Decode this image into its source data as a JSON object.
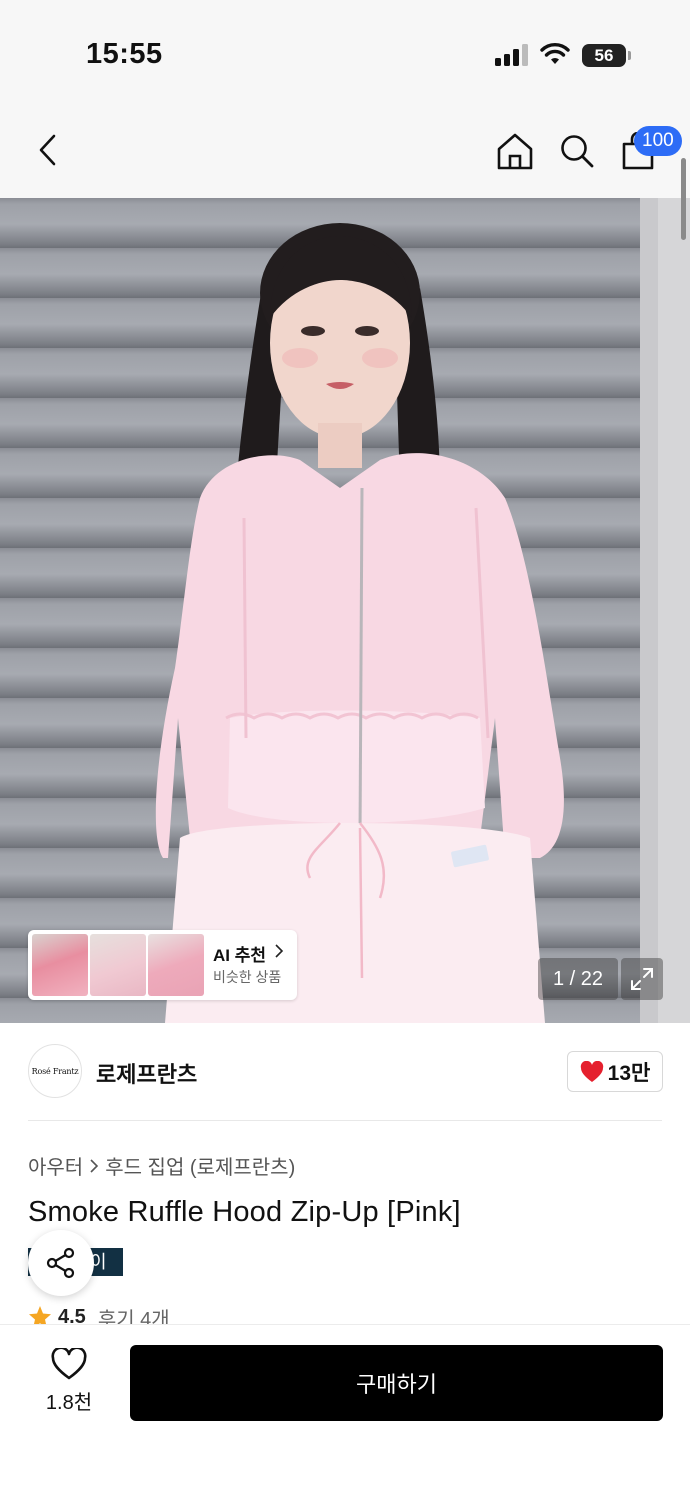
{
  "status_bar": {
    "time": "15:55",
    "battery": "56"
  },
  "nav": {
    "cart_badge": "100"
  },
  "hero": {
    "recommendation": {
      "title": "AI 추천",
      "subtitle": "비슷한 상품"
    },
    "pager": "1 / 22"
  },
  "brand": {
    "logo_text": "Rosé Frantz",
    "name": "로제프란츠",
    "likes": "13만"
  },
  "product": {
    "breadcrumb": [
      "아우터",
      "후드 집업 (로제프란츠)"
    ],
    "title": "Smoke Ruffle Hood Zip-Up [Pink]",
    "tag": "이",
    "rating": "4.5",
    "reviews": "후기 4개"
  },
  "bottom": {
    "wish_count": "1.8천",
    "buy_label": "구매하기"
  },
  "colors": {
    "accent_blue": "#2d6cf6",
    "heart_red": "#e5202e",
    "tag_navy": "#123043",
    "star_orange": "#f5a623"
  }
}
